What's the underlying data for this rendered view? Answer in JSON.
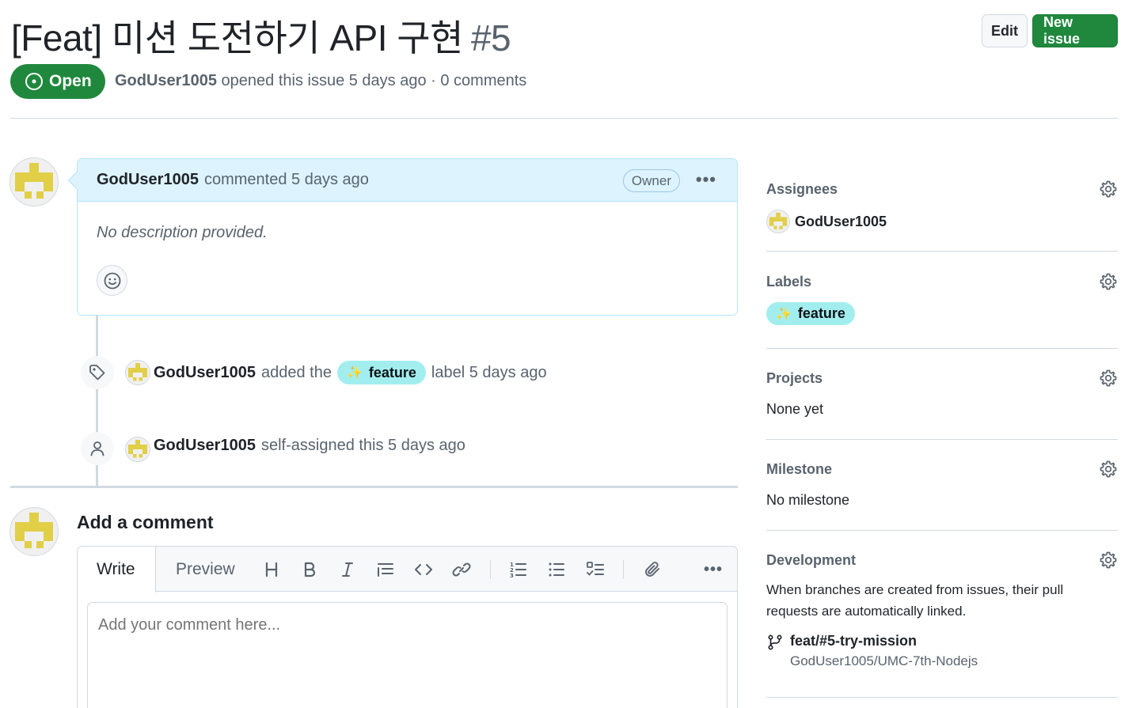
{
  "issue": {
    "title": "[Feat] 미션 도전하기 API 구현",
    "number": "#5",
    "state": "Open",
    "author": "GodUser1005",
    "meta_text": "opened this issue 5 days ago · 0 comments"
  },
  "header_buttons": {
    "edit": "Edit",
    "new_issue": "New issue"
  },
  "comment": {
    "author": "GodUser1005",
    "time": "commented 5 days ago",
    "badge": "Owner",
    "more": "•••",
    "body": "No description provided."
  },
  "timeline": [
    {
      "icon": "tag-icon",
      "user": "GodUser1005",
      "pre": "added the",
      "label": "feature",
      "post": "label 5 days ago"
    },
    {
      "icon": "person-icon",
      "user": "GodUser1005",
      "text": "self-assigned this 5 days ago"
    }
  ],
  "add_comment": {
    "title": "Add a comment",
    "tab_write": "Write",
    "tab_preview": "Preview",
    "placeholder": "Add your comment here...",
    "more": "•••"
  },
  "sidebar": {
    "assignees": {
      "title": "Assignees",
      "user": "GodUser1005"
    },
    "labels": {
      "title": "Labels",
      "label": "feature",
      "label_color": "#a2eeef"
    },
    "projects": {
      "title": "Projects",
      "value": "None yet"
    },
    "milestone": {
      "title": "Milestone",
      "value": "No milestone"
    },
    "development": {
      "title": "Development",
      "text": "When branches are created from issues, their pull requests are automatically linked.",
      "branch": "feat/#5-try-mission",
      "repo": "GodUser1005/UMC-7th-Nodejs"
    }
  },
  "colors": {
    "open_green": "#1f883d",
    "comment_header_bg": "#ddf4ff",
    "label_bg": "#a2eeef",
    "identicon": "#e1cf48"
  }
}
